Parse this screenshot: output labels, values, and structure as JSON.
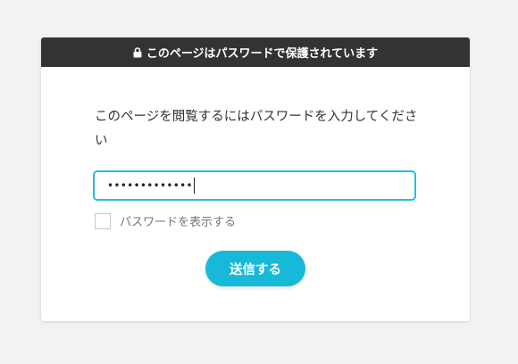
{
  "banner": {
    "icon": "lock-icon",
    "text": "このページはパスワードで保護されています"
  },
  "form": {
    "prompt": "このページを閲覧するにはパスワードを入力してください",
    "password_value": "•••••••••••••",
    "show_password_label": "パスワードを表示する",
    "show_password_checked": false,
    "submit_label": "送信する"
  },
  "colors": {
    "banner_bg": "#333333",
    "accent": "#17b9d8",
    "page_bg": "#f2f2f2"
  }
}
